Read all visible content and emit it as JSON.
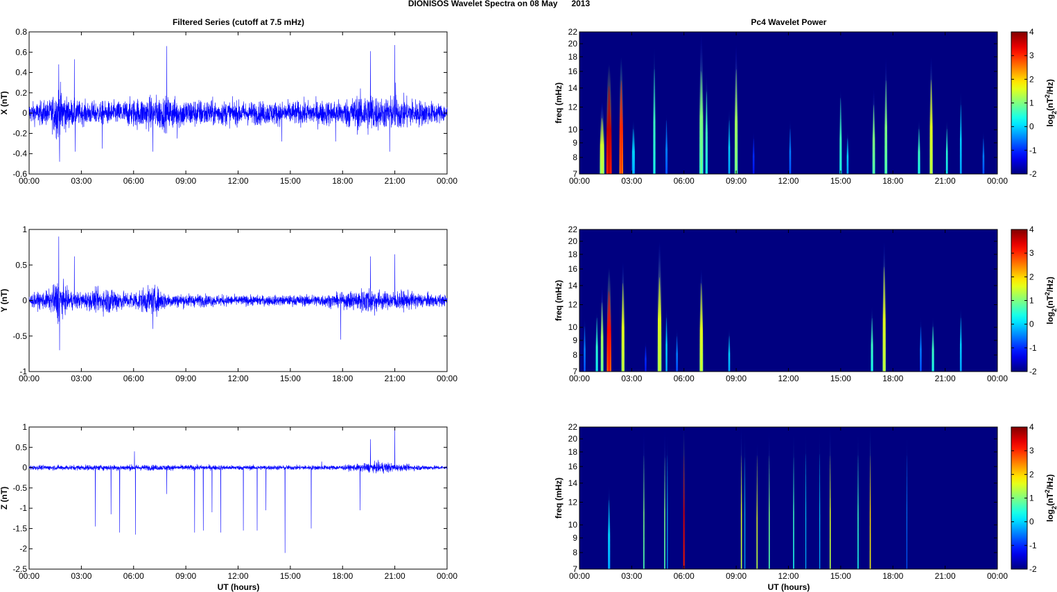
{
  "chart_data": {
    "type": "line",
    "title": "DIONISOS Wavelet Spectra on 08 May      2013",
    "left_title": "Filtered Series (cutoff at 7.5 mHz)",
    "right_title": "Pc4 Wavelet Power",
    "xlabel": "UT (hours)",
    "xlim": [
      0,
      24
    ],
    "xticks": [
      "00:00",
      "03:00",
      "06:00",
      "09:00",
      "12:00",
      "15:00",
      "18:00",
      "21:00",
      "00:00"
    ],
    "series_color": "#0000ff",
    "series": [
      {
        "name": "X",
        "ylabel": "X (nT)",
        "ylim": [
          -0.6,
          0.8
        ],
        "yticks": [
          -0.6,
          -0.4,
          -0.2,
          0,
          0.2,
          0.4,
          0.6,
          0.8
        ],
        "envelope": [
          [
            0,
            0.07
          ],
          [
            1.2,
            0.09
          ],
          [
            1.7,
            0.2
          ],
          [
            2.2,
            0.1
          ],
          [
            3,
            0.08
          ],
          [
            5,
            0.08
          ],
          [
            6,
            0.1
          ],
          [
            7.5,
            0.12
          ],
          [
            9,
            0.1
          ],
          [
            12,
            0.08
          ],
          [
            15,
            0.08
          ],
          [
            18,
            0.09
          ],
          [
            19.6,
            0.15
          ],
          [
            20.2,
            0.1
          ],
          [
            21,
            0.12
          ],
          [
            24,
            0.06
          ]
        ],
        "spikes": [
          [
            1.7,
            0.48
          ],
          [
            1.75,
            -0.48
          ],
          [
            2.6,
            0.53
          ],
          [
            2.65,
            -0.38
          ],
          [
            4.2,
            -0.35
          ],
          [
            7.1,
            -0.38
          ],
          [
            7.9,
            0.66
          ],
          [
            8.5,
            -0.25
          ],
          [
            14.5,
            -0.28
          ],
          [
            17.6,
            -0.28
          ],
          [
            19.6,
            0.61
          ],
          [
            20.7,
            -0.38
          ],
          [
            21.0,
            0.67
          ],
          [
            21.05,
            0.3
          ]
        ]
      },
      {
        "name": "Y",
        "ylabel": "Y (nT)",
        "ylim": [
          -1,
          1
        ],
        "yticks": [
          -1,
          -0.5,
          0,
          0.5,
          1
        ],
        "envelope": [
          [
            0,
            0.06
          ],
          [
            1.2,
            0.1
          ],
          [
            1.7,
            0.22
          ],
          [
            2.2,
            0.1
          ],
          [
            3,
            0.08
          ],
          [
            4.8,
            0.14
          ],
          [
            5.5,
            0.08
          ],
          [
            7.2,
            0.14
          ],
          [
            8,
            0.07
          ],
          [
            12,
            0.05
          ],
          [
            15,
            0.05
          ],
          [
            18,
            0.07
          ],
          [
            19.6,
            0.14
          ],
          [
            20.5,
            0.08
          ],
          [
            21,
            0.1
          ],
          [
            24,
            0.05
          ]
        ],
        "spikes": [
          [
            1.7,
            0.9
          ],
          [
            1.75,
            -0.7
          ],
          [
            2.6,
            0.62
          ],
          [
            7.1,
            -0.4
          ],
          [
            17.9,
            -0.55
          ],
          [
            19.6,
            0.62
          ],
          [
            21.0,
            0.65
          ]
        ]
      },
      {
        "name": "Z",
        "ylabel": "Z (nT)",
        "ylim": [
          -2.5,
          1
        ],
        "yticks": [
          -2.5,
          -2,
          -1.5,
          -1,
          -0.5,
          0,
          0.5,
          1
        ],
        "envelope": [
          [
            0,
            0.04
          ],
          [
            6,
            0.05
          ],
          [
            12,
            0.04
          ],
          [
            18,
            0.04
          ],
          [
            19.5,
            0.08
          ],
          [
            20.5,
            0.1
          ],
          [
            21,
            0.06
          ],
          [
            24,
            0.03
          ]
        ],
        "spikes": [
          [
            3.8,
            -1.45
          ],
          [
            4.7,
            -1.15
          ],
          [
            5.2,
            -1.6
          ],
          [
            6.1,
            -1.65
          ],
          [
            6.05,
            0.4
          ],
          [
            7.9,
            -0.65
          ],
          [
            9.5,
            -1.6
          ],
          [
            10.0,
            -1.55
          ],
          [
            10.5,
            -1.1
          ],
          [
            11.0,
            -1.6
          ],
          [
            12.3,
            -1.55
          ],
          [
            13.1,
            -1.55
          ],
          [
            13.6,
            -1.05
          ],
          [
            14.7,
            -2.1
          ],
          [
            16.2,
            -1.5
          ],
          [
            16.8,
            0.15
          ],
          [
            19.0,
            -1.05
          ],
          [
            19.6,
            0.7
          ],
          [
            21.0,
            0.97
          ]
        ]
      }
    ],
    "spectra": {
      "type": "heatmap",
      "ylabel": "freq (mHz)",
      "ylim": [
        7,
        22
      ],
      "yscale": "log",
      "yticks": [
        7,
        8,
        9,
        10,
        12,
        14,
        16,
        18,
        20,
        22
      ],
      "clim": [
        -2,
        4
      ],
      "cbar_ticks": [
        -2,
        -1,
        0,
        1,
        2,
        3,
        4
      ],
      "cbar_label": "log2(nT2/Hz)",
      "panels": [
        {
          "component": "X",
          "events": [
            [
              1.3,
              1.5,
              13,
              0.12
            ],
            [
              1.7,
              3.6,
              17,
              0.14
            ],
            [
              2.4,
              3,
              18,
              0.1
            ],
            [
              3.1,
              0,
              11,
              0.08
            ],
            [
              4.3,
              0.6,
              20,
              0.06
            ],
            [
              5.0,
              -0.5,
              12,
              0.06
            ],
            [
              7.0,
              1,
              22,
              0.1
            ],
            [
              7.3,
              0.6,
              16,
              0.06
            ],
            [
              8.6,
              0,
              12,
              0.05
            ],
            [
              9.0,
              1.2,
              20,
              0.08
            ],
            [
              10,
              -1,
              10,
              0.05
            ],
            [
              12.1,
              -0.5,
              11,
              0.05
            ],
            [
              15.0,
              0.6,
              15,
              0.06
            ],
            [
              15.4,
              0,
              10,
              0.05
            ],
            [
              16.9,
              1,
              14,
              0.07
            ],
            [
              17.6,
              1,
              18,
              0.07
            ],
            [
              19.5,
              0.6,
              11,
              0.06
            ],
            [
              20.2,
              1.6,
              18,
              0.08
            ],
            [
              21.1,
              0.5,
              11,
              0.05
            ],
            [
              21.9,
              0,
              14,
              0.05
            ],
            [
              23.2,
              -0.5,
              10,
              0.05
            ]
          ]
        },
        {
          "component": "Y",
          "events": [
            [
              0.3,
              -0.5,
              11,
              0.05
            ],
            [
              1.0,
              0.5,
              12,
              0.06
            ],
            [
              1.3,
              1.2,
              14,
              0.07
            ],
            [
              1.7,
              3.2,
              17,
              0.12
            ],
            [
              2.5,
              1.6,
              17,
              0.08
            ],
            [
              3.8,
              -1,
              9,
              0.05
            ],
            [
              4.6,
              1.6,
              20,
              0.1
            ],
            [
              5.0,
              0,
              12,
              0.05
            ],
            [
              5.6,
              -0.5,
              10,
              0.05
            ],
            [
              7.0,
              1.6,
              17,
              0.09
            ],
            [
              8.6,
              0,
              10,
              0.05
            ],
            [
              16.8,
              0.6,
              12,
              0.06
            ],
            [
              17.5,
              1.6,
              20,
              0.08
            ],
            [
              19.6,
              -0.5,
              11,
              0.05
            ],
            [
              20.3,
              0.6,
              11,
              0.06
            ],
            [
              21.9,
              0,
              12,
              0.05
            ]
          ]
        },
        {
          "component": "Z",
          "events": [
            [
              1.7,
              0,
              14,
              0.06
            ],
            [
              3.7,
              1,
              22,
              0.03
            ],
            [
              4.9,
              1,
              22,
              0.03
            ],
            [
              5.05,
              0,
              22,
              0.02
            ],
            [
              6.0,
              3.5,
              22,
              0.035
            ],
            [
              9.3,
              1.6,
              22,
              0.03
            ],
            [
              9.5,
              0,
              22,
              0.02
            ],
            [
              10.2,
              1.6,
              22,
              0.03
            ],
            [
              10.9,
              1,
              22,
              0.03
            ],
            [
              12.3,
              0.6,
              22,
              0.03
            ],
            [
              13.0,
              0,
              22,
              0.02
            ],
            [
              13.8,
              0,
              22,
              0.02
            ],
            [
              14.4,
              1.6,
              22,
              0.03
            ],
            [
              16.0,
              0.6,
              22,
              0.03
            ],
            [
              16.7,
              2,
              22,
              0.03
            ],
            [
              18.8,
              -0.5,
              22,
              0.02
            ]
          ]
        }
      ]
    }
  }
}
